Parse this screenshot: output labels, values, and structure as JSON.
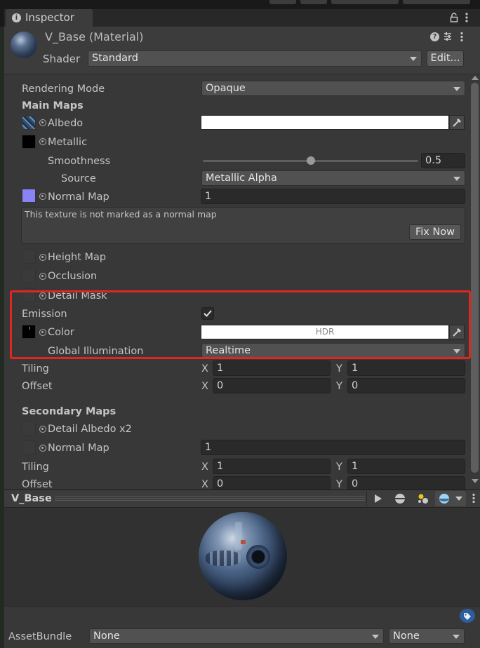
{
  "tab": {
    "title": "Inspector"
  },
  "header": {
    "material_name": "V_Base (Material)",
    "shader_label": "Shader",
    "shader_value": "Standard",
    "edit_button": "Edit..."
  },
  "props": {
    "rendering_mode_label": "Rendering Mode",
    "rendering_mode_value": "Opaque",
    "main_maps_title": "Main Maps",
    "albedo_label": "Albedo",
    "metallic_label": "Metallic",
    "smoothness_label": "Smoothness",
    "smoothness_value": "0.5",
    "smoothness_fraction": 0.5,
    "source_label": "Source",
    "source_value": "Metallic Alpha",
    "normal_map_label": "Normal Map",
    "normal_map_value": "1",
    "warning_text": "This texture is not marked as a normal map",
    "fix_now_button": "Fix Now",
    "height_map_label": "Height Map",
    "occlusion_label": "Occlusion",
    "detail_mask_label": "Detail Mask",
    "emission_label": "Emission",
    "color_label": "Color",
    "hdr_label": "HDR",
    "gi_label": "Global Illumination",
    "gi_value": "Realtime",
    "tiling_label": "Tiling",
    "offset_label": "Offset",
    "x_label": "X",
    "y_label": "Y",
    "main_tiling_x": "1",
    "main_tiling_y": "1",
    "main_offset_x": "0",
    "main_offset_y": "0",
    "secondary_maps_title": "Secondary Maps",
    "detail_albedo_label": "Detail Albedo x2",
    "secondary_normal_label": "Normal Map",
    "secondary_normal_value": "1",
    "sec_tiling_x": "1",
    "sec_tiling_y": "1",
    "sec_offset_x": "0",
    "sec_offset_y": "0"
  },
  "preview": {
    "title": "V_Base"
  },
  "footer": {
    "assetbundle_label": "AssetBundle",
    "assetbundle_value": "None",
    "variant_value": "None"
  },
  "colors": {
    "highlight": "#e0261e",
    "albedo_color": "#ffffff",
    "normal_swatch": "#8a83f5"
  }
}
